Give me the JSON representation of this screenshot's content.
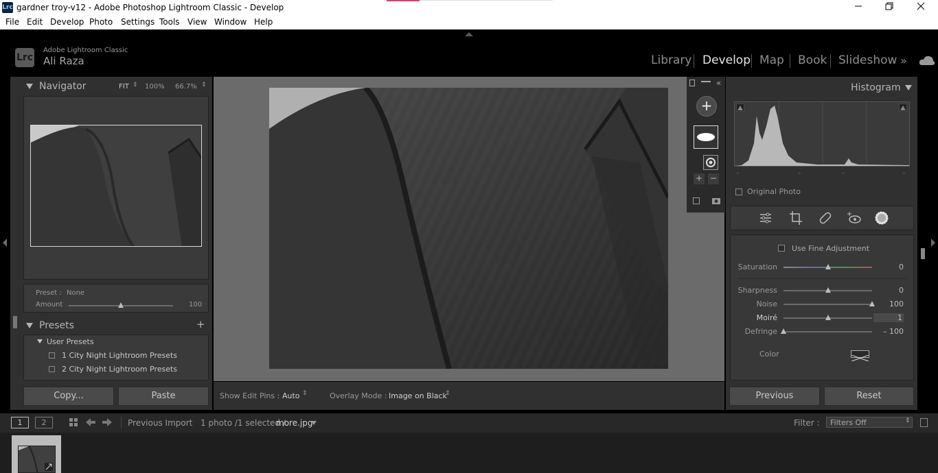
{
  "window": {
    "title": "gardner troy-v12 - Adobe Photoshop Lightroom Classic - Develop",
    "app_icon": "Lrc",
    "minimize_icon": "minimize-icon",
    "restore_icon": "restore-icon",
    "close_icon": "close-icon"
  },
  "menu": [
    "File",
    "Edit",
    "Develop",
    "Photo",
    "Settings",
    "Tools",
    "View",
    "Window",
    "Help"
  ],
  "identity": {
    "logo": "Lrc",
    "app_name": "Adobe Lightroom Classic",
    "user": "Ali Raza"
  },
  "modules": [
    "Library",
    "Develop",
    "Map",
    "Book",
    "Slideshow"
  ],
  "active_module": "Develop",
  "navigator": {
    "title": "Navigator",
    "zoom_fit": "FIT",
    "zoom_100": "100%",
    "zoom_custom": "66.7%"
  },
  "preset_amount": {
    "preset_label": "Preset :",
    "preset_value": "None",
    "amount_label": "Amount",
    "amount_value": "100"
  },
  "presets": {
    "title": "Presets",
    "group": "User Presets",
    "items": [
      "1 City Night Lightroom Presets",
      "2 City Night Lightroom Presets"
    ]
  },
  "left_buttons": {
    "copy": "Copy...",
    "paste": "Paste"
  },
  "toolbar": {
    "edit_pins_label": "Show Edit Pins :",
    "edit_pins_value": "Auto",
    "overlay_label": "Overlay Mode :",
    "overlay_value": "Image on Black"
  },
  "histogram": {
    "title": "Histogram",
    "original_photo": "Original Photo",
    "ticks": [
      "–",
      "–",
      "–",
      "–"
    ]
  },
  "adjustments": {
    "fine_adjustment": "Use Fine Adjustment",
    "sliders": [
      {
        "label": "Saturation",
        "value": "0",
        "level": 0.5
      },
      {
        "label": "Sharpness",
        "value": "0",
        "level": 0.5
      },
      {
        "label": "Noise",
        "value": "100",
        "level": 1.0
      },
      {
        "label": "Moiré",
        "value": "1",
        "level": 0.5
      },
      {
        "label": "Defringe",
        "value": "– 100",
        "level": 0.0
      }
    ],
    "color_label": "Color"
  },
  "right_buttons": {
    "previous": "Previous",
    "reset": "Reset"
  },
  "filmstrip": {
    "view1": "1",
    "view2": "2",
    "source": "Previous Import",
    "count": "1 photo /1 selected /",
    "filename": "more.jpg",
    "filter_label": "Filter :",
    "filter_value": "Filters Off"
  },
  "colors": {
    "bg": "#000000",
    "panel": "#303030",
    "center": "#6b6b6b",
    "accent": "#d9426f"
  }
}
